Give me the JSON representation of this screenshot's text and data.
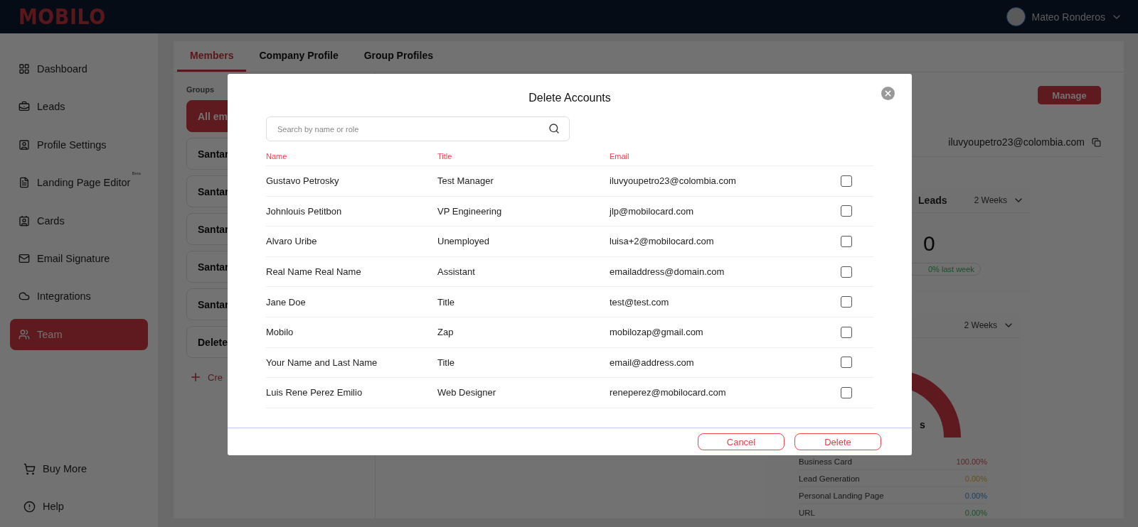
{
  "header": {
    "logo": "MOBILO",
    "user": {
      "name": "Mateo Ronderos"
    }
  },
  "sidebar": {
    "items": [
      {
        "label": "Dashboard",
        "selected": false
      },
      {
        "label": "Leads",
        "selected": false
      },
      {
        "label": "Profile Settings",
        "selected": false
      },
      {
        "label": "Landing Page Editor",
        "badge": "Beta",
        "selected": false
      },
      {
        "label": "Cards",
        "selected": false
      },
      {
        "label": "Email Signature",
        "selected": false
      },
      {
        "label": "Integrations",
        "selected": false
      },
      {
        "label": "Team",
        "selected": true
      }
    ],
    "footer_items": [
      {
        "label": "Buy More"
      },
      {
        "label": "Help"
      }
    ]
  },
  "tabs": [
    {
      "label": "Members",
      "selected": true
    },
    {
      "label": "Company Profile",
      "selected": false
    },
    {
      "label": "Group Profiles",
      "selected": false
    }
  ],
  "groups": {
    "heading": "Groups",
    "items": [
      {
        "label": "All em",
        "selected": true
      },
      {
        "label": "Santar",
        "selected": false
      },
      {
        "label": "Santar",
        "selected": false
      },
      {
        "label": "Santar",
        "selected": false
      },
      {
        "label": "Santar",
        "selected": false
      },
      {
        "label": "Santar",
        "selected": false
      },
      {
        "label": "Delete",
        "selected": false
      }
    ],
    "create_label": "Cre"
  },
  "manage_button": "Manage",
  "profile_email": "iluvyoupetro23@colombia.com",
  "leads_card": {
    "title": "Leads",
    "period": "2 Weeks",
    "count": "0",
    "change": "0% last week"
  },
  "sources_card": {
    "period": "2 Weeks",
    "chart_label": "s",
    "legend": [
      {
        "label": "Business Card",
        "value": "100.00%",
        "color": "#651f22"
      },
      {
        "label": "Lead Generation",
        "value": "0.00%",
        "color": "#68510f"
      },
      {
        "label": "Personal Landing Page",
        "value": "0.00%",
        "color": "#154065"
      },
      {
        "label": "URL",
        "value": "0.00%",
        "color": "#145323"
      }
    ]
  },
  "modal": {
    "title": "Delete Accounts",
    "search": {
      "placeholder": "Search by name or role"
    },
    "columns": [
      "Name",
      "Title",
      "Email"
    ],
    "rows": [
      {
        "name": "Gustavo Petrosky",
        "title": "Test Manager",
        "email": "iluvyoupetro23@colombia.com",
        "checked": false
      },
      {
        "name": "Johnlouis Petitbon",
        "title": "VP Engineering",
        "email": "jlp@mobilocard.com",
        "checked": false
      },
      {
        "name": "Alvaro Uribe",
        "title": "Unemployed",
        "email": "luisa+2@mobilocard.com",
        "checked": false
      },
      {
        "name": "Real Name Real Name",
        "title": "Assistant",
        "email": "emailaddress@domain.com",
        "checked": false
      },
      {
        "name": "Jane Doe",
        "title": "Title",
        "email": "test@test.com",
        "checked": false
      },
      {
        "name": "Mobilo",
        "title": "Zap",
        "email": "mobilozap@gmail.com",
        "checked": false
      },
      {
        "name": "Your Name and Last Name",
        "title": "Title",
        "email": "email@address.com",
        "checked": false
      },
      {
        "name": "Luis Rene Perez Emilio",
        "title": "Web Designer",
        "email": "reneperez@mobilocard.com",
        "checked": false
      }
    ],
    "buttons": [
      {
        "label": "Cancel",
        "kind": "cancel"
      },
      {
        "label": "Delete",
        "kind": "delete"
      }
    ]
  }
}
